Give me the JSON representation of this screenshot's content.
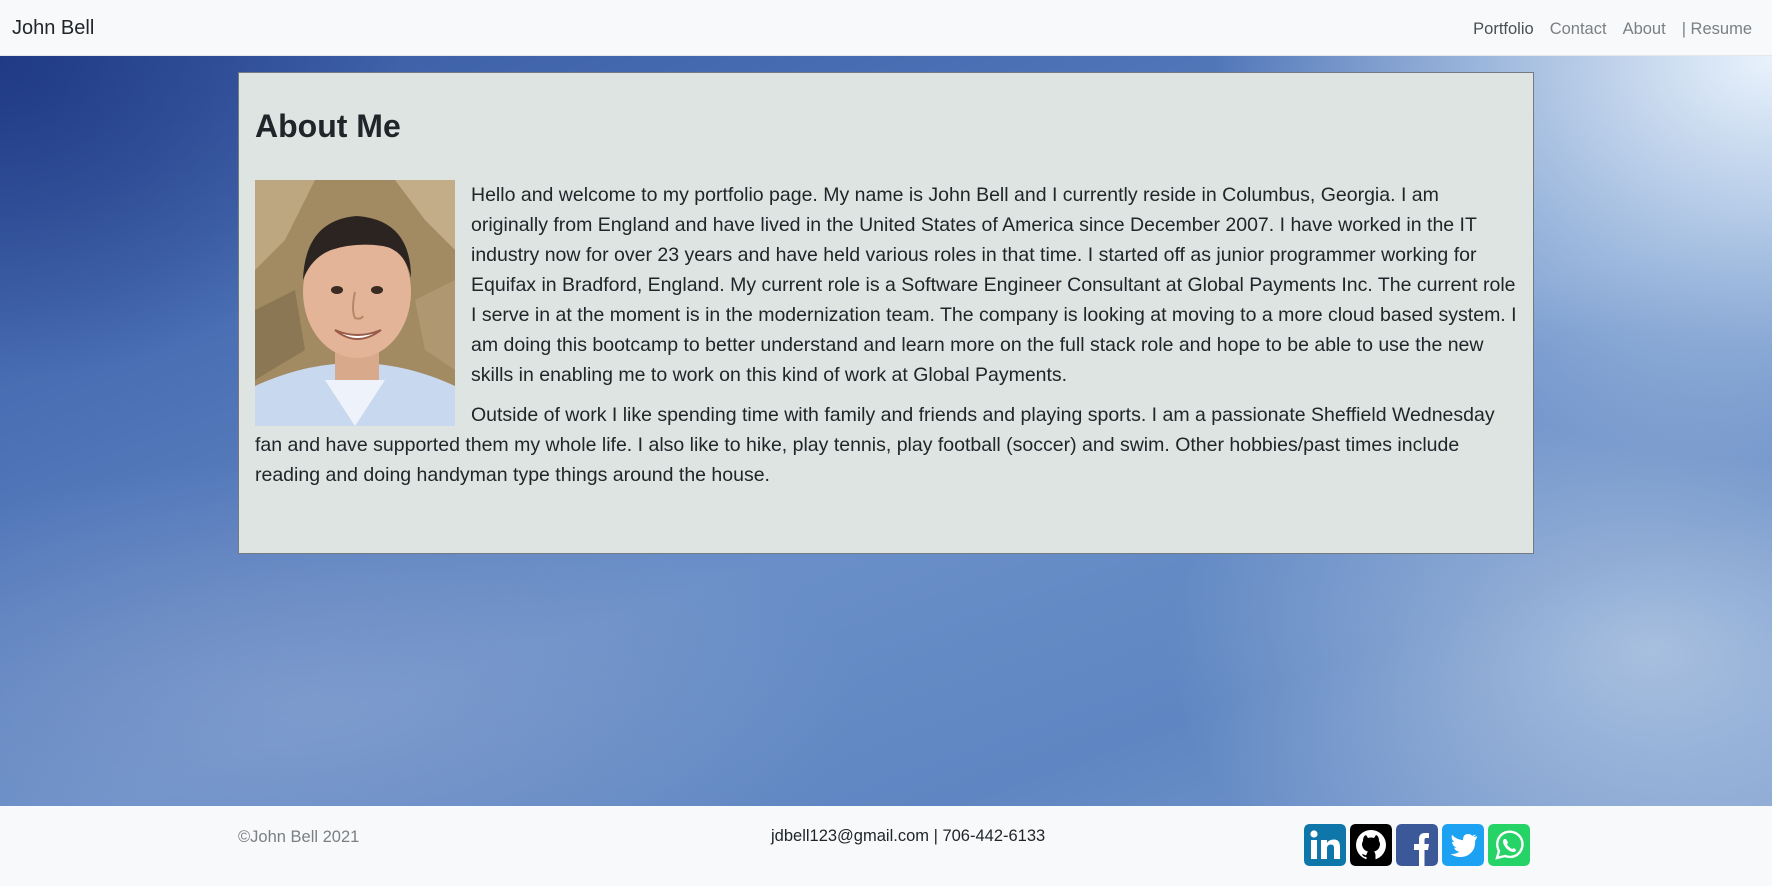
{
  "header": {
    "brand": "John Bell",
    "nav": [
      {
        "label": "Portfolio",
        "active": true
      },
      {
        "label": "Contact",
        "active": false
      },
      {
        "label": "About",
        "active": false
      },
      {
        "label": "| Resume",
        "active": false
      }
    ]
  },
  "about": {
    "title": "About Me",
    "avatar_icon": "profile-photo",
    "paragraph1": "Hello and welcome to my portfolio page. My name is John Bell and I currently reside in Columbus, Georgia. I am originally from England and have lived in the United States of America since December 2007. I have worked in the IT industry now for over 23 years and have held various roles in that time. I started off as junior programmer working for Equifax in Bradford, England. My current role is a Software Engineer Consultant at Global Payments Inc. The current role I serve in at the moment is in the modernization team. The company is looking at moving to a more cloud based system. I am doing this bootcamp to better understand and learn more on the full stack role and hope to be able to use the new skills in enabling me to work on this kind of work at Global Payments.",
    "paragraph2": "Outside of work I like spending time with family and friends and playing sports. I am a passionate Sheffield Wednesday fan and have supported them my whole life. I also like to hike, play tennis, play football (soccer) and swim. Other hobbies/past times include reading and doing handyman type things around the house."
  },
  "footer": {
    "copyright": "©John Bell 2021",
    "contact": "jdbell123@gmail.com | 706-442-6133",
    "social": [
      {
        "icon": "linkedin-icon",
        "color": "#0e76a8"
      },
      {
        "icon": "github-icon",
        "color": "#000000"
      },
      {
        "icon": "facebook-icon",
        "color": "#3b5998"
      },
      {
        "icon": "twitter-icon",
        "color": "#1da1f2"
      },
      {
        "icon": "whatsapp-icon",
        "color": "#25d366"
      }
    ]
  }
}
